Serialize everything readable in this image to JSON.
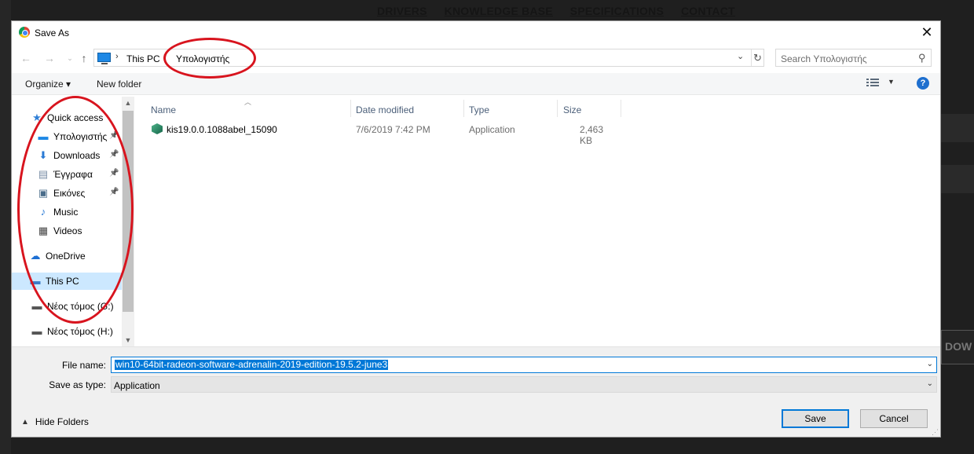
{
  "background": {
    "nav": [
      "DRIVERS",
      "KNOWLEDGE BASE",
      "SPECIFICATIONS",
      "CONTACT"
    ],
    "right_button_fragment": "DOW"
  },
  "dialog": {
    "title": "Save As",
    "close": "✕",
    "address": {
      "crumbs": [
        "This PC",
        "Υπολογιστής"
      ],
      "separator": "›"
    },
    "search_placeholder": "Search Υπολογιστής",
    "toolbar": {
      "organize": "Organize ▾",
      "new_folder": "New folder",
      "help": "?"
    },
    "nav_items": [
      {
        "label": "Quick access",
        "icon": "star-icon",
        "glyph": "★",
        "color": "#2f7fd6",
        "pinned": false
      },
      {
        "label": "Υπολογιστής",
        "icon": "computer-icon",
        "glyph": "▬",
        "color": "#1e88e5",
        "pinned": true
      },
      {
        "label": "Downloads",
        "icon": "download-icon",
        "glyph": "⬇",
        "color": "#2a7ad5",
        "pinned": true
      },
      {
        "label": "Έγγραφα",
        "icon": "document-icon",
        "glyph": "▤",
        "color": "#7a8ea6",
        "pinned": true
      },
      {
        "label": "Εικόνες",
        "icon": "pictures-icon",
        "glyph": "▣",
        "color": "#4a6c8a",
        "pinned": true
      },
      {
        "label": "Music",
        "icon": "music-icon",
        "glyph": "♪",
        "color": "#2a7ad5",
        "pinned": false
      },
      {
        "label": "Videos",
        "icon": "video-icon",
        "glyph": "▦",
        "color": "#444444",
        "pinned": false
      },
      {
        "label": "OneDrive",
        "icon": "cloud-icon",
        "glyph": "☁",
        "color": "#1d6fd3",
        "pinned": false
      },
      {
        "label": "This PC",
        "icon": "pc-icon",
        "glyph": "▬",
        "color": "#3a7bc8",
        "pinned": false
      },
      {
        "label": "Νέος τόμος (G:)",
        "icon": "drive-icon",
        "glyph": "▬",
        "color": "#555555",
        "pinned": false
      },
      {
        "label": "Νέος τόμος (H:)",
        "icon": "drive-icon",
        "glyph": "▬",
        "color": "#555555",
        "pinned": false
      }
    ],
    "columns": [
      "Name",
      "Date modified",
      "Type",
      "Size"
    ],
    "files": [
      {
        "name": "kis19.0.0.1088abel_15090",
        "date": "7/6/2019 7:42 PM",
        "type": "Application",
        "size": "2,463 KB"
      }
    ],
    "file_name_label": "File name:",
    "file_name_value": "win10-64bit-radeon-software-adrenalin-2019-edition-19.5.2-june3",
    "save_type_label": "Save as type:",
    "save_type_value": "Application",
    "hide_folders": "Hide Folders",
    "save_button": "Save",
    "cancel_button": "Cancel"
  },
  "annotation_color": "#d8141e"
}
